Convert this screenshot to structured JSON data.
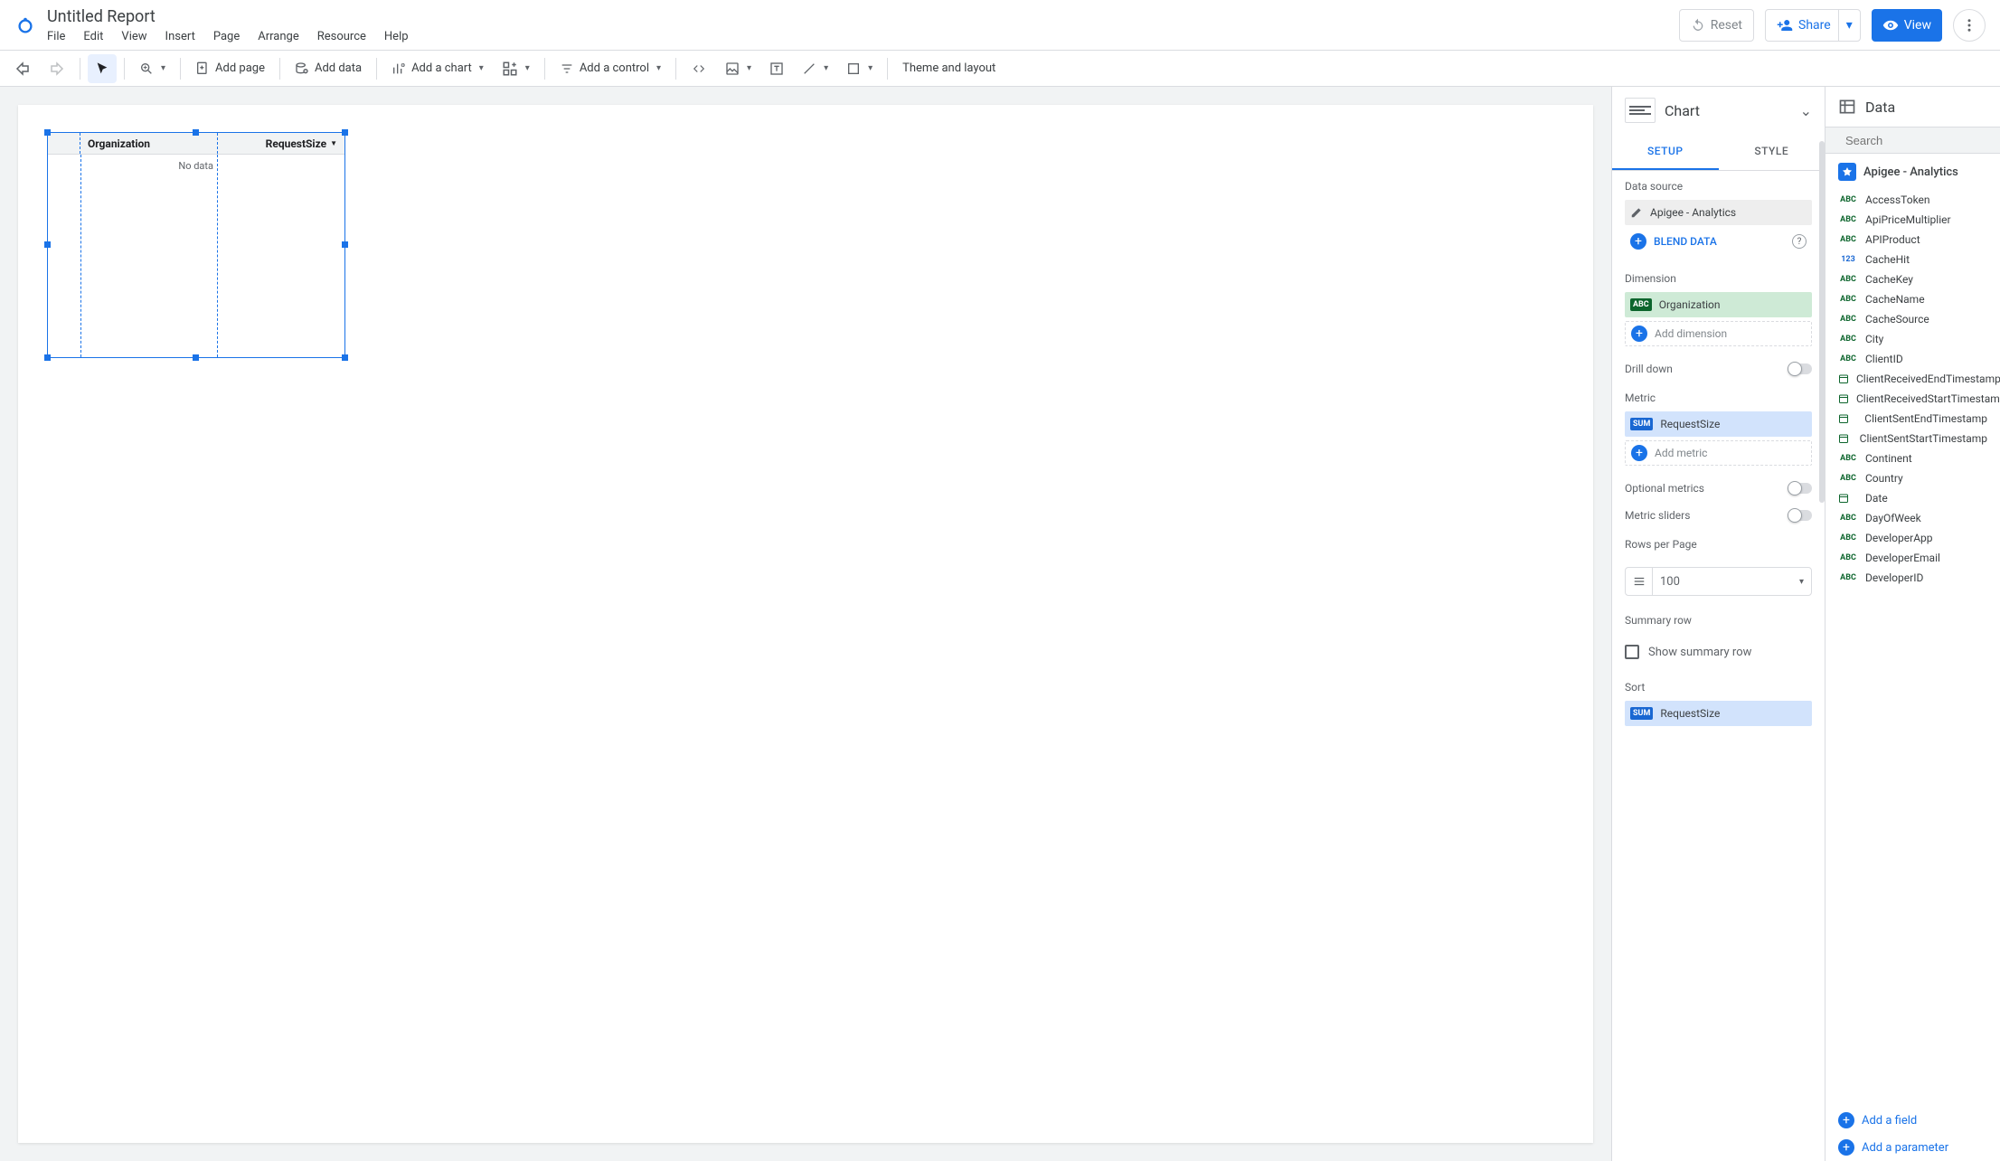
{
  "doc_title": "Untitled Report",
  "menubar": [
    "File",
    "Edit",
    "View",
    "Insert",
    "Page",
    "Arrange",
    "Resource",
    "Help"
  ],
  "top_actions": {
    "reset": "Reset",
    "share": "Share",
    "view": "View"
  },
  "toolbar": {
    "add_page": "Add page",
    "add_data": "Add data",
    "add_chart": "Add a chart",
    "add_control": "Add a control",
    "theme": "Theme and layout"
  },
  "canvas_widget": {
    "col1": "Organization",
    "col2": "RequestSize",
    "body": "No data"
  },
  "chart_panel": {
    "title": "Chart",
    "tab_setup": "SETUP",
    "tab_style": "STYLE",
    "data_source_label": "Data source",
    "data_source_value": "Apigee - Analytics",
    "blend": "BLEND DATA",
    "dimension_label": "Dimension",
    "dimension_value": "Organization",
    "add_dimension": "Add dimension",
    "drill_down": "Drill down",
    "metric_label": "Metric",
    "metric_badge": "SUM",
    "metric_value": "RequestSize",
    "add_metric": "Add metric",
    "optional_metrics": "Optional metrics",
    "metric_sliders": "Metric sliders",
    "rows_label": "Rows per Page",
    "rows_value": "100",
    "summary_label": "Summary row",
    "show_summary": "Show summary row",
    "sort_label": "Sort",
    "sort_value": "RequestSize"
  },
  "data_panel": {
    "title": "Data",
    "search_placeholder": "Search",
    "source": "Apigee - Analytics",
    "fields": [
      {
        "type": "abc",
        "name": "AccessToken"
      },
      {
        "type": "abc",
        "name": "ApiPriceMultiplier"
      },
      {
        "type": "abc",
        "name": "APIProduct"
      },
      {
        "type": "123",
        "name": "CacheHit"
      },
      {
        "type": "abc",
        "name": "CacheKey"
      },
      {
        "type": "abc",
        "name": "CacheName"
      },
      {
        "type": "abc",
        "name": "CacheSource"
      },
      {
        "type": "abc",
        "name": "City"
      },
      {
        "type": "abc",
        "name": "ClientID"
      },
      {
        "type": "date",
        "name": "ClientReceivedEndTimestamp"
      },
      {
        "type": "date",
        "name": "ClientReceivedStartTimestamp"
      },
      {
        "type": "date",
        "name": "ClientSentEndTimestamp"
      },
      {
        "type": "date",
        "name": "ClientSentStartTimestamp"
      },
      {
        "type": "abc",
        "name": "Continent"
      },
      {
        "type": "abc",
        "name": "Country"
      },
      {
        "type": "date",
        "name": "Date"
      },
      {
        "type": "abc",
        "name": "DayOfWeek"
      },
      {
        "type": "abc",
        "name": "DeveloperApp"
      },
      {
        "type": "abc",
        "name": "DeveloperEmail"
      },
      {
        "type": "abc",
        "name": "DeveloperID"
      }
    ],
    "add_field": "Add a field",
    "add_param": "Add a parameter"
  }
}
